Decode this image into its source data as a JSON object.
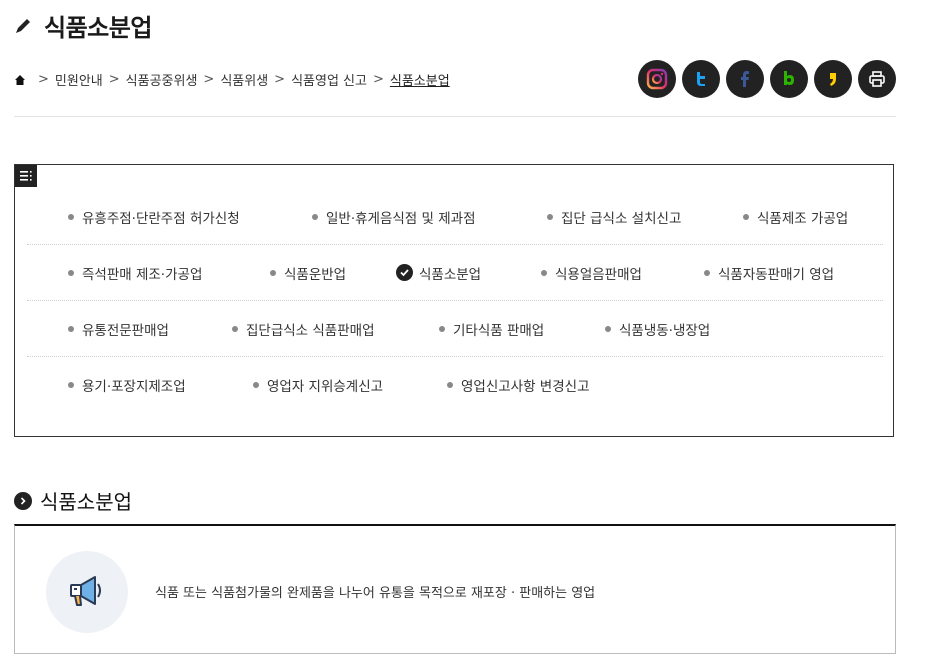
{
  "page": {
    "title": "식품소분업"
  },
  "breadcrumb": {
    "home_icon": "home-icon",
    "items": [
      "민원안내",
      "식품공중위생",
      "식품위생",
      "식품영업 신고",
      "식품소분업"
    ],
    "separator": ">"
  },
  "social": [
    {
      "name": "instagram-icon",
      "color": "#e1306c"
    },
    {
      "name": "twitter-icon",
      "color": "#1da1f2"
    },
    {
      "name": "facebook-icon",
      "color": "#3b5998"
    },
    {
      "name": "blog-icon",
      "color": "#2db400"
    },
    {
      "name": "kakaostory-icon",
      "color": "#ffcd00"
    },
    {
      "name": "print-icon",
      "color": "#ffffff"
    }
  ],
  "categories": {
    "rows": [
      [
        "유흥주점·단란주점 허가신청",
        "일반·휴게음식점 및 제과점",
        "집단 급식소 설치신고",
        "식품제조 가공업"
      ],
      [
        "즉석판매 제조·가공업",
        "식품운반업",
        "식품소분업",
        "식용얼음판매업",
        "식품자동판매기 영업"
      ],
      [
        "유통전문판매업",
        "집단급식소 식품판매업",
        "기타식품 판매업",
        "식품냉동·냉장업"
      ],
      [
        "용기·포장지제조업",
        "영업자 지위승계신고",
        "영업신고사항 변경신고"
      ]
    ],
    "selected": "식품소분업"
  },
  "section": {
    "title": "식품소분업",
    "description": "식품 또는 식품첨가물의 완제품을 나누어 유통을 목적으로 재포장 · 판매하는 영업",
    "icon": "megaphone-icon"
  },
  "colors": {
    "dark": "#222222",
    "bullet": "#888888",
    "icon_bg": "#eef1f5"
  }
}
